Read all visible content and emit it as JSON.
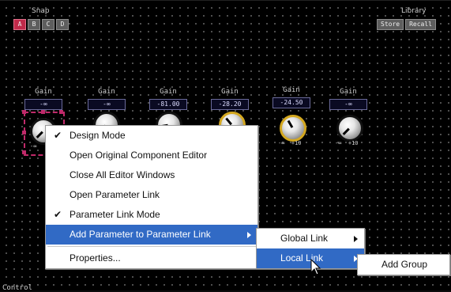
{
  "snap": {
    "label": "Snap",
    "buttons": [
      "A",
      "B",
      "C",
      "D"
    ],
    "active": "A"
  },
  "library": {
    "label": "Library",
    "store": "Store",
    "recall": "Recall"
  },
  "gains": [
    {
      "label": "Gain",
      "value": "-∞"
    },
    {
      "label": "Gain",
      "value": "-∞"
    },
    {
      "label": "Gain",
      "value": "-81.00"
    },
    {
      "label": "Gain",
      "value": "-28.20"
    },
    {
      "label": "Gain",
      "value": "-24.50"
    },
    {
      "label": "Gain",
      "value": "-∞"
    }
  ],
  "range": {
    "min": "-∞",
    "max": "+10"
  },
  "context_menu": {
    "items": [
      {
        "label": "Design Mode",
        "checked": true
      },
      {
        "label": "Open Original Component Editor",
        "checked": false
      },
      {
        "label": "Close All Editor Windows",
        "checked": false
      },
      {
        "label": "Open Parameter Link",
        "checked": false
      },
      {
        "label": "Parameter Link Mode",
        "checked": true
      },
      {
        "label": "Add Parameter to Parameter Link",
        "submenu": true,
        "highlighted": true
      },
      {
        "label": "Properties...",
        "checked": false
      }
    ],
    "check_glyph": "✔"
  },
  "submenu": {
    "items": [
      {
        "label": "Global Link",
        "submenu": true
      },
      {
        "label": "Local Link",
        "submenu": true,
        "highlighted": true
      }
    ]
  },
  "submenu2": {
    "items": [
      {
        "label": "Add Group"
      }
    ]
  },
  "status_text": "Control",
  "colors": {
    "highlight": "#316ac5",
    "selection": "#c02a6a",
    "knob_gold": "#d4a820"
  }
}
